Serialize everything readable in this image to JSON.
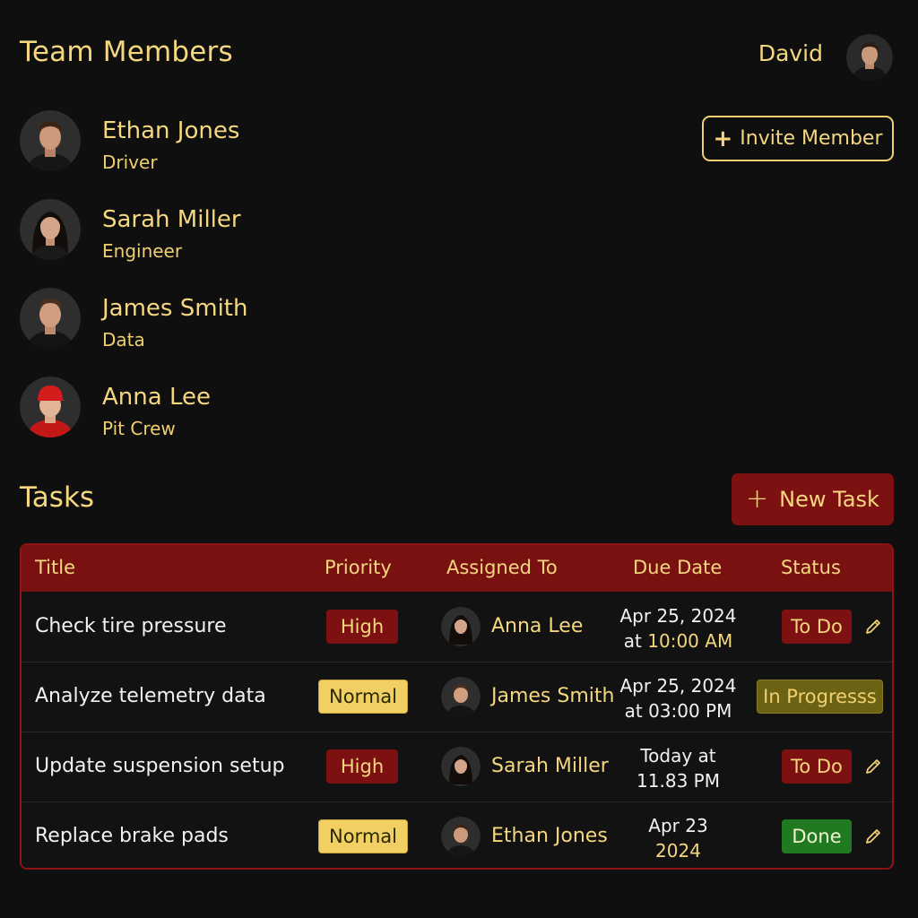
{
  "header": {
    "title": "Team Members",
    "user_name": "David",
    "user_avatar_icon": "user-avatar-icon"
  },
  "members": [
    {
      "name": "Ethan Jones",
      "role": "Driver",
      "avatar": "ethan-avatar"
    },
    {
      "name": "Sarah Miller",
      "role": "Engineer",
      "avatar": "sarah-avatar"
    },
    {
      "name": "James Smith",
      "role": "Data",
      "avatar": "james-avatar"
    },
    {
      "name": "Anna Lee",
      "role": "Pit Crew",
      "avatar": "anna-avatar"
    }
  ],
  "invite_button": {
    "label": "Invite Member",
    "icon": "+"
  },
  "tasks": {
    "title": "Tasks",
    "new_task_label": "New Task",
    "new_task_icon": "+",
    "columns": [
      "Title",
      "Priority",
      "Assigned To",
      "Due Date",
      "Status"
    ],
    "rows": [
      {
        "title": "Check tire pressure",
        "priority": "High",
        "assignee": "Anna Lee",
        "due_line1": "Apr 25, 2024",
        "due_prefix": "at",
        "due_accent": "10:00 AM",
        "status": "To Do",
        "editable": true
      },
      {
        "title": "Analyze telemetry data",
        "priority": "Normal",
        "assignee": "James Smith",
        "due_line1": "Apr 25, 2024",
        "due_line2": "at 03:00 PM",
        "status": "In Progresss",
        "editable": false
      },
      {
        "title": "Update suspension setup",
        "priority": "High",
        "assignee": "Sarah Miller",
        "due_line1": "Today at",
        "due_line2": "11.83 PM",
        "status": "To Do",
        "editable": true
      },
      {
        "title": "Replace brake pads",
        "priority": "Normal",
        "assignee": "Ethan Jones",
        "due_line1": "Apr 23",
        "due_accent": "2024",
        "status": "Done",
        "editable": true
      }
    ]
  },
  "colors": {
    "background": "#0f0f0f",
    "accent_gold": "#f4d77f",
    "accent_red": "#7d1010",
    "done_green": "#1f7a22",
    "progress_olive": "#6b6213"
  }
}
